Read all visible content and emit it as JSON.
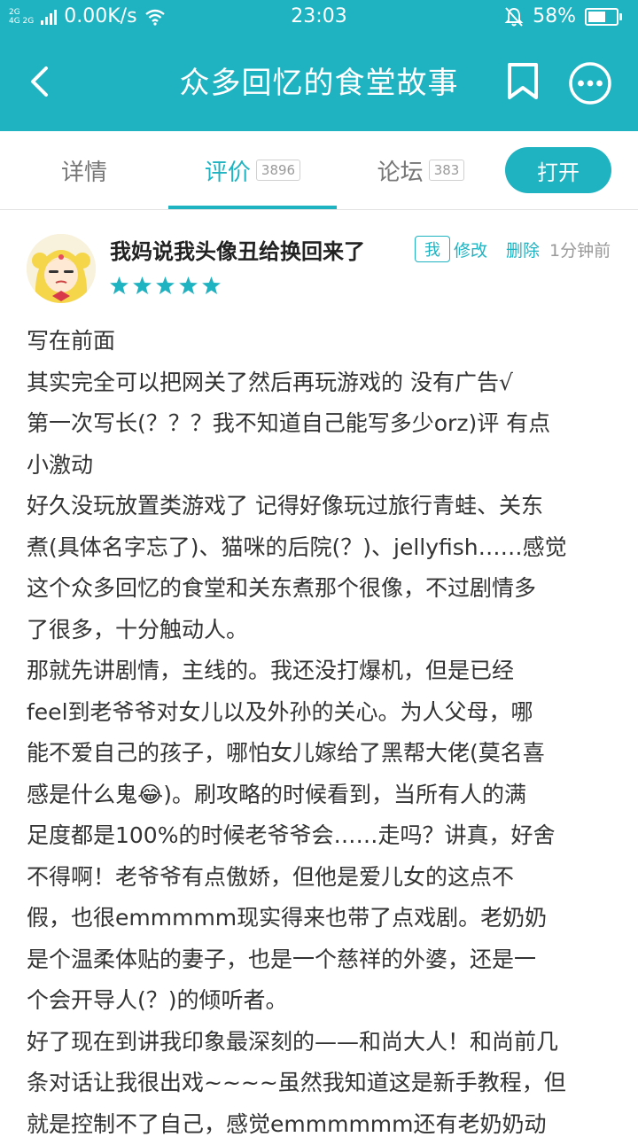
{
  "status_bar": {
    "signal_top": "2G",
    "signal_bottom": "4G 2G",
    "net_speed": "0.00K/s",
    "time": "23:03",
    "battery": "58%"
  },
  "header": {
    "title": "众多回忆的食堂故事",
    "background_color": "#1fb3c2"
  },
  "tabs": [
    {
      "label": "详情",
      "count": ""
    },
    {
      "label": "评价",
      "count": "3896"
    },
    {
      "label": "论坛",
      "count": "383"
    }
  ],
  "open_button": "打开",
  "review": {
    "username": "我妈说我头像丑给换回来了",
    "me_badge": "我",
    "edit": "修改",
    "delete": "删除",
    "time_ago": "1分钟前",
    "rating": 5,
    "lines": [
      "写在前面",
      "其实完全可以把网关了然后再玩游戏的 没有广告√",
      "第一次写长(？？？我不知道自己能写多少orz)评 有点",
      "小激动",
      "好久没玩放置类游戏了 记得好像玩过旅行青蛙、关东",
      "煮(具体名字忘了)、猫咪的后院(？)、jellyfish……感觉",
      "这个众多回忆的食堂和关东煮那个很像，不过剧情多",
      "了很多，十分触动人。",
      "那就先讲剧情，主线的。我还没打爆机，但是已经",
      "feel到老爷爷对女儿以及外孙的关心。为人父母，哪",
      "能不爱自己的孩子，哪怕女儿嫁给了黑帮大佬(莫名喜",
      "感是什么鬼😂)。刷攻略的时候看到，当所有人的满",
      "足度都是100%的时候老爷爷会……走吗？讲真，好舍",
      "不得啊！老爷爷有点傲娇，但他是爱儿女的这点不",
      "假，也很emmmmm现实得来也带了点戏剧。老奶奶",
      "是个温柔体贴的妻子，也是一个慈祥的外婆，还是一",
      "个会开导人(？)的倾听者。",
      "好了现在到讲我印象最深刻的——和尚大人！和尚前几",
      "条对话让我很出戏~~~~虽然我知道这是新手教程，但",
      "就是控制不了自己，感觉emmmmmm还有老奶奶动"
    ]
  }
}
